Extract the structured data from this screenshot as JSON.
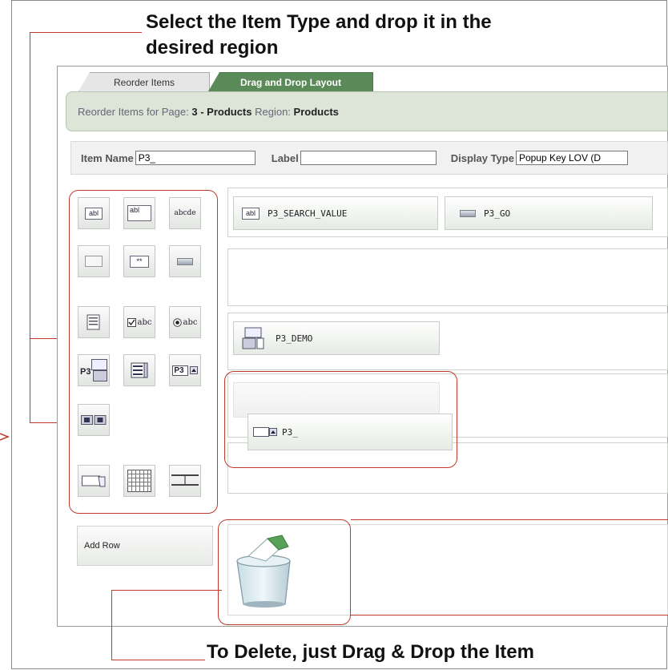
{
  "annotations": {
    "top_line1": "Select the Item Type and drop it in the",
    "top_line2": "desired region",
    "bottom": "To Delete, just Drag & Drop the Item"
  },
  "tabs": {
    "reorder_label": "Reorder Items",
    "dnd_label": "Drag and Drop Layout"
  },
  "header": {
    "prefix": "Reorder Items for Page:",
    "page_value": "3 - Products",
    "region_label": "Region:",
    "region_value": "Products"
  },
  "filters": {
    "item_name_label": "Item Name",
    "item_name_value": "P3_",
    "label_label": "Label",
    "label_value": "",
    "display_type_label": "Display Type",
    "display_type_value": "Popup Key LOV (D"
  },
  "palette": {
    "abl_small": "abl",
    "abl_large": "abl",
    "abcde": "abcde",
    "password": "**",
    "checkbox_label": "abc",
    "radio_label": "abc",
    "shuttle_label": "P3",
    "popup_label": "P3"
  },
  "layout_items": {
    "search_value": "P3_SEARCH_VALUE",
    "search_icon_text": "abl",
    "go_button": "P3_GO",
    "demo": "P3_DEMO",
    "dragged": "P3_"
  },
  "add_row_label": "Add Row",
  "colors": {
    "accent_green": "#5a8a58",
    "annotation_red": "#c0392b"
  }
}
